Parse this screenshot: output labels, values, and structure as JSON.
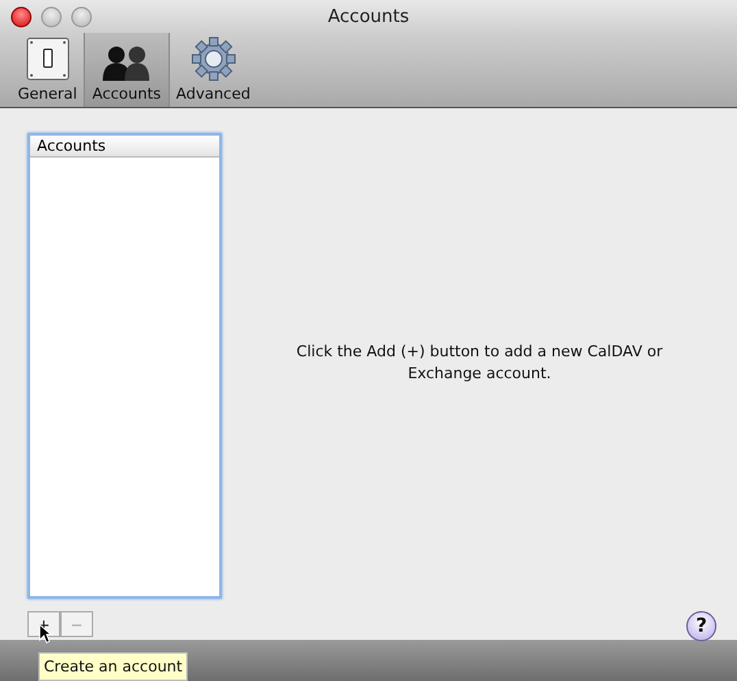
{
  "window": {
    "title": "Accounts"
  },
  "tabs": [
    {
      "label": "General",
      "kind": "switch",
      "selected": false
    },
    {
      "label": "Accounts",
      "kind": "people",
      "selected": true
    },
    {
      "label": "Advanced",
      "kind": "gear",
      "selected": false
    }
  ],
  "account_list": {
    "header": "Accounts"
  },
  "message": "Click the Add (+) button to add a new CalDAV or Exchange account.",
  "add_button": "+",
  "remove_button": {
    "label": "−",
    "disabled": true
  },
  "help_button": "?",
  "tooltip": "Create an account"
}
